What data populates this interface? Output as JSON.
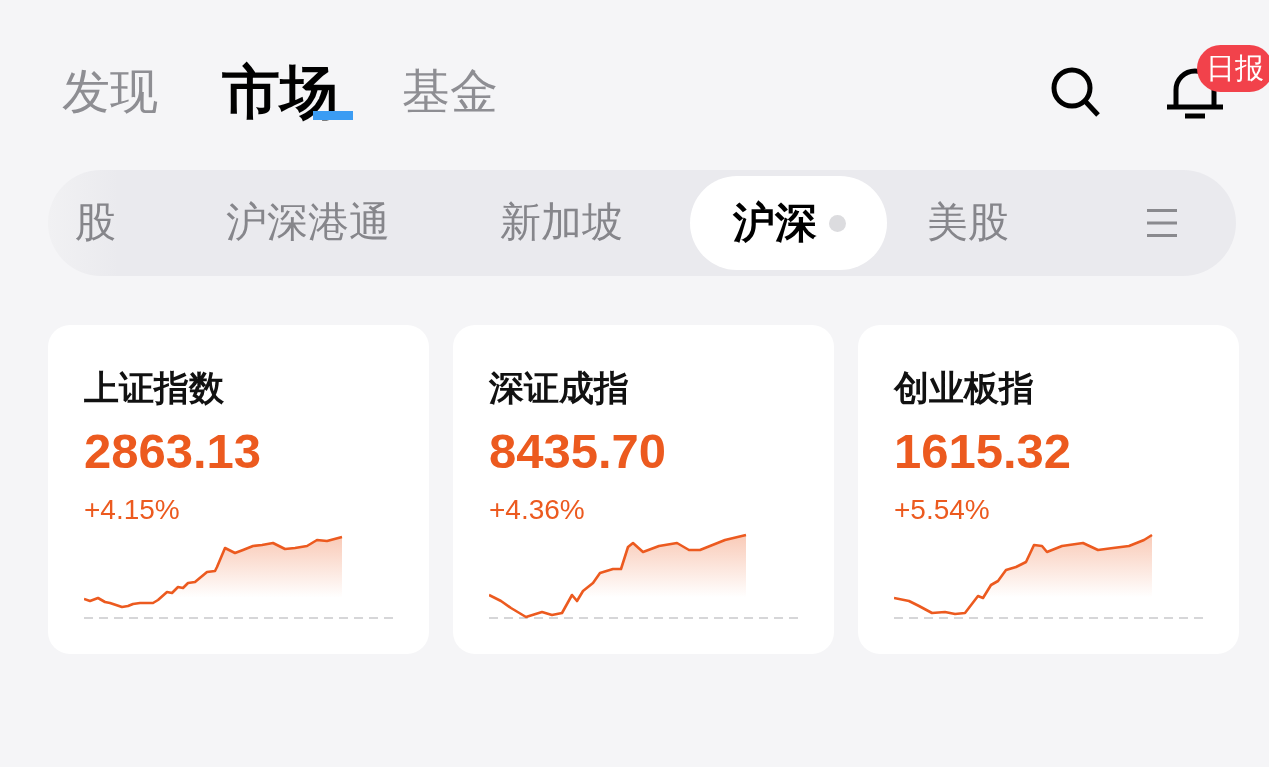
{
  "top_nav": {
    "tabs": [
      {
        "label": "发现",
        "selected": false
      },
      {
        "label": "市场",
        "selected": true
      },
      {
        "label": "基金",
        "selected": false
      }
    ],
    "notification_badge": "日报"
  },
  "market_tabs": [
    {
      "label": "股",
      "selected": false
    },
    {
      "label": "沪深港通",
      "selected": false
    },
    {
      "label": "新加坡",
      "selected": false
    },
    {
      "label": "沪深",
      "selected": true
    },
    {
      "label": "美股",
      "selected": false
    }
  ],
  "index_cards": [
    {
      "name": "上证指数",
      "value": "2863.13",
      "change": "+4.15%",
      "rising": true
    },
    {
      "name": "深证成指",
      "value": "8435.70",
      "change": "+4.36%",
      "rising": true
    },
    {
      "name": "创业板指",
      "value": "1615.32",
      "change": "+5.54%",
      "rising": true
    }
  ]
}
